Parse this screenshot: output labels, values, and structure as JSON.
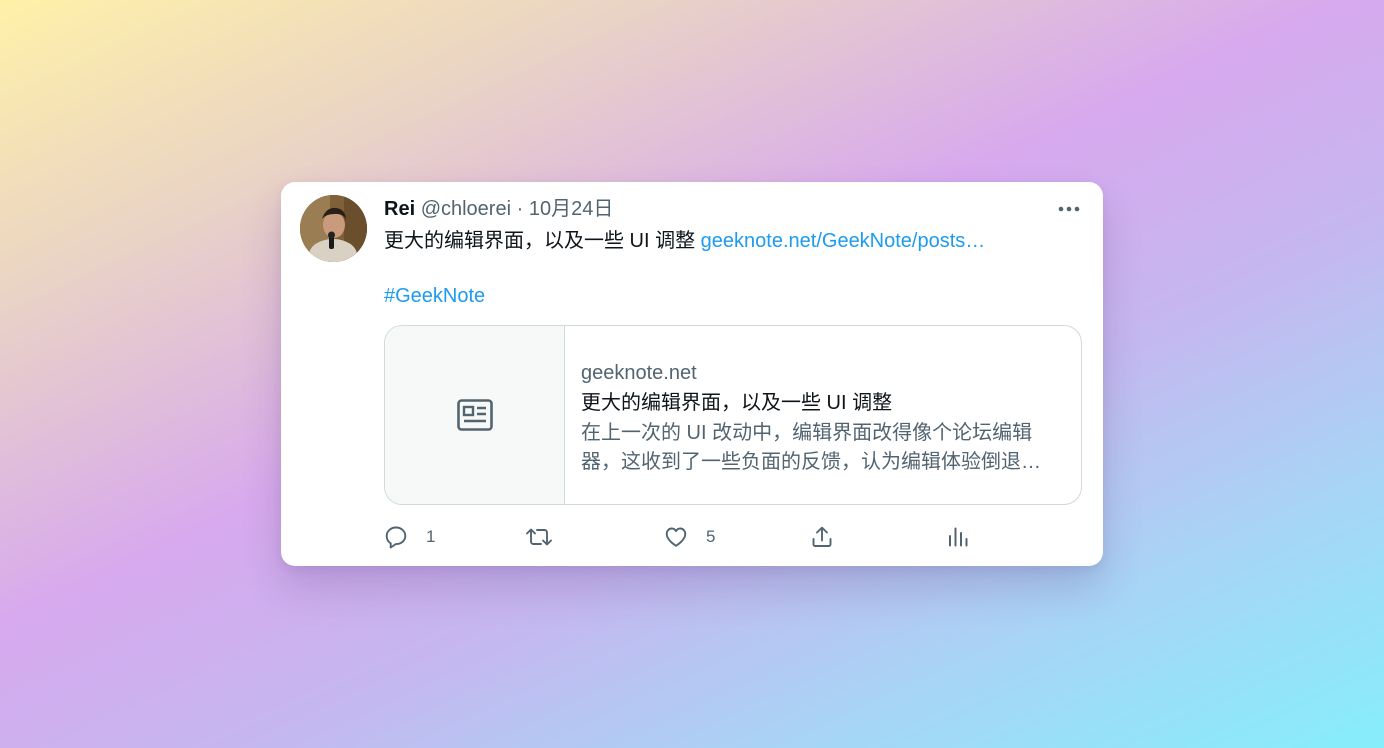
{
  "tweet": {
    "author_name": "Rei",
    "author_handle": "@chloerei",
    "separator": "·",
    "date": "10月24日",
    "text": "更大的编辑界面，以及一些 UI 调整 ",
    "link_text": "geeknote.net/GeekNote/posts…",
    "hashtag": "#GeekNote"
  },
  "link_card": {
    "domain": "geeknote.net",
    "title": "更大的编辑界面，以及一些 UI 调整",
    "description": "在上一次的 UI 改动中，编辑界面改得像个论坛编辑器，这收到了一些负面的反馈，认为编辑体验倒退…",
    "thumbnail_icon": "article-icon"
  },
  "actions": {
    "reply_count": "1",
    "retweet_count": "",
    "like_count": "5",
    "icons": [
      "reply-icon",
      "retweet-icon",
      "like-icon",
      "share-icon",
      "analytics-icon"
    ]
  },
  "colors": {
    "link": "#1d9bf0",
    "text_primary": "#0f1419",
    "text_secondary": "#536471",
    "border": "#cfd9de"
  }
}
